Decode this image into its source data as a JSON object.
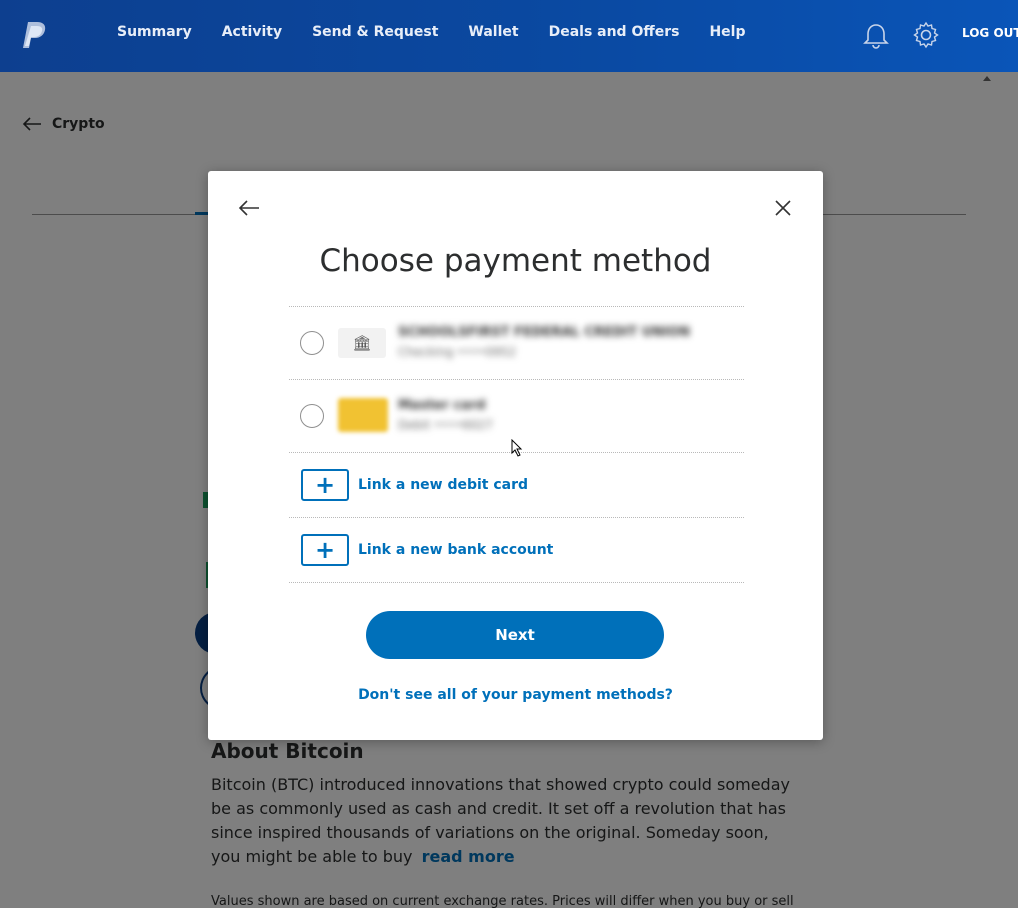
{
  "header": {
    "nav": [
      "Summary",
      "Activity",
      "Send & Request",
      "Wallet",
      "Deals and Offers",
      "Help"
    ],
    "logout_label": "LOG OUT",
    "icons": [
      "paypal-logo",
      "bell-icon",
      "gear-icon"
    ],
    "brand_color": "#0a4aa3"
  },
  "page": {
    "back_label": "Crypto",
    "about_title": "About Bitcoin",
    "about_text": "Bitcoin (BTC) introduced innovations that showed crypto could someday be as commonly used as cash and credit. It set off a revolution that has since inspired thousands of variations on the original. Someday soon, you might be able to buy",
    "read_more": "read more",
    "values_note": "Values shown are based on current exchange rates. Prices will differ when you buy or sell"
  },
  "modal": {
    "title": "Choose payment method",
    "payment_methods": [
      {
        "type": "bank",
        "icon": "bank-icon",
        "name": "SCHOOLSFIRST FEDERAL CREDIT UNION",
        "sub": "Checking ••••0952",
        "selected": false
      },
      {
        "type": "card",
        "icon": "card-icon",
        "name": "Master card",
        "sub": "Debit ••••6027",
        "selected": false
      }
    ],
    "link_debit": "Link a new debit card",
    "link_bank": "Link a new bank account",
    "next_label": "Next",
    "dont_see_label": "Don't see all of your payment methods?",
    "accent_color": "#0070ba"
  }
}
